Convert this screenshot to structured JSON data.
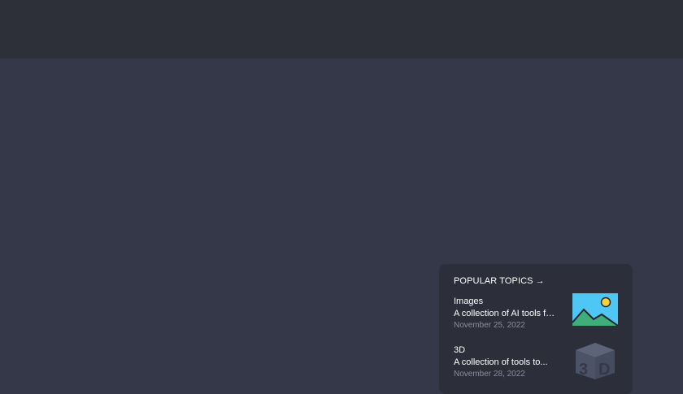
{
  "popular": {
    "header": "POPULAR TOPICS",
    "arrow": "→",
    "topics": [
      {
        "title": "Images",
        "description": "A collection of AI tools for...",
        "date": "November 25, 2022",
        "icon": "image-icon"
      },
      {
        "title": "3D",
        "description": "A collection of tools to...",
        "date": "November 28, 2022",
        "icon": "3d-cube-icon"
      }
    ]
  },
  "colors": {
    "topbar": "#2e3039",
    "background": "#353848",
    "card": "#2c2f3a",
    "date_text": "#8a8d99",
    "image_sky": "#4fc7f5",
    "image_hills": "#3fae7a",
    "image_sun": "#f6d23b"
  }
}
